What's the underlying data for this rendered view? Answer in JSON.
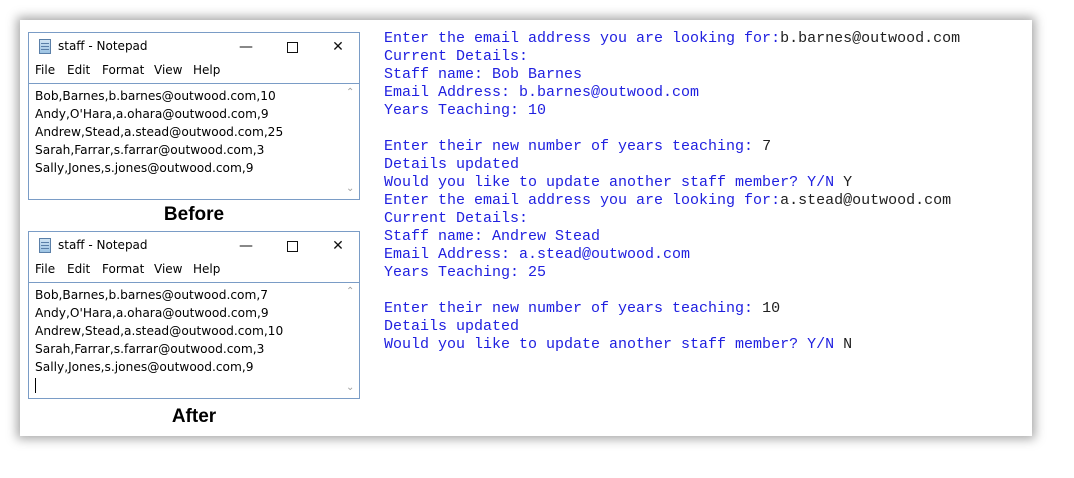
{
  "before": {
    "window_title": "staff - Notepad",
    "caption": "Before",
    "lines": [
      "Bob,Barnes,b.barnes@outwood.com,10",
      "Andy,O'Hara,a.ohara@outwood.com,9",
      "Andrew,Stead,a.stead@outwood.com,25",
      "Sarah,Farrar,s.farrar@outwood.com,3",
      "Sally,Jones,s.jones@outwood.com,9"
    ]
  },
  "after": {
    "window_title": "staff - Notepad",
    "caption": "After",
    "lines": [
      "Bob,Barnes,b.barnes@outwood.com,7",
      "Andy,O'Hara,a.ohara@outwood.com,9",
      "Andrew,Stead,a.stead@outwood.com,10",
      "Sarah,Farrar,s.farrar@outwood.com,3",
      "Sally,Jones,s.jones@outwood.com,9"
    ]
  },
  "menu": {
    "file": "File",
    "edit": "Edit",
    "format": "Format",
    "view": "View",
    "help": "Help"
  },
  "window_controls": {
    "minimize": "—",
    "close": "✕"
  },
  "console": [
    {
      "prompt": "Enter the email address you are looking for:",
      "input": "b.barnes@outwood.com"
    },
    {
      "prompt": "Current Details:",
      "input": ""
    },
    {
      "prompt": "Staff name: Bob Barnes",
      "input": ""
    },
    {
      "prompt": "Email Address: b.barnes@outwood.com",
      "input": ""
    },
    {
      "prompt": "Years Teaching: 10",
      "input": ""
    },
    {
      "prompt": "",
      "input": ""
    },
    {
      "prompt": "Enter their new number of years teaching: ",
      "input": "7"
    },
    {
      "prompt": "Details updated",
      "input": ""
    },
    {
      "prompt": "Would you like to update another staff member? Y/N ",
      "input": "Y"
    },
    {
      "prompt": "Enter the email address you are looking for:",
      "input": "a.stead@outwood.com"
    },
    {
      "prompt": "Current Details:",
      "input": ""
    },
    {
      "prompt": "Staff name: Andrew Stead",
      "input": ""
    },
    {
      "prompt": "Email Address: a.stead@outwood.com",
      "input": ""
    },
    {
      "prompt": "Years Teaching: 25",
      "input": ""
    },
    {
      "prompt": "",
      "input": ""
    },
    {
      "prompt": "Enter their new number of years teaching: ",
      "input": "10"
    },
    {
      "prompt": "Details updated",
      "input": ""
    },
    {
      "prompt": "Would you like to update another staff member? Y/N ",
      "input": "N"
    }
  ],
  "colors": {
    "console_output": "#2020e0",
    "console_input": "#202020",
    "window_border": "#7a9cc6"
  }
}
